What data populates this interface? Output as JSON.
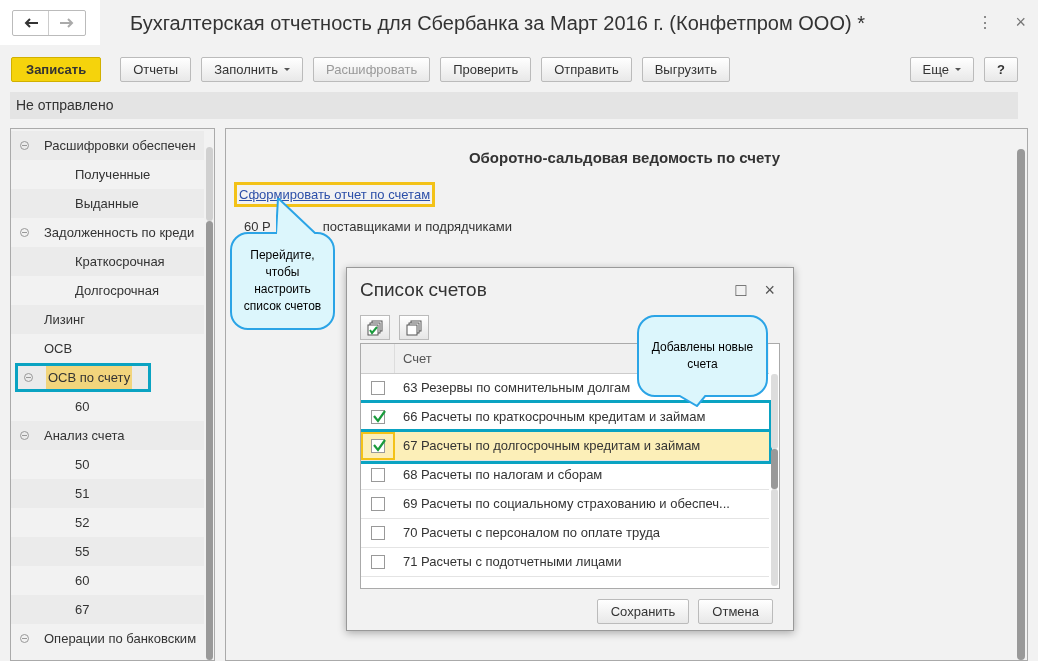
{
  "window": {
    "title": "Бухгалтерская отчетность для Сбербанка за Март 2016 г. (Конфетпром ООО) *",
    "forward_disabled": true,
    "more_icon": "⋮",
    "close_icon": "×"
  },
  "toolbar": {
    "buttons": [
      {
        "label": "Записать",
        "kind": "primary",
        "disabled": false,
        "dropdown": false
      },
      {
        "label": "Отчеты",
        "kind": "normal",
        "disabled": false,
        "dropdown": false
      },
      {
        "label": "Заполнить",
        "kind": "normal",
        "disabled": false,
        "dropdown": true
      },
      {
        "label": "Расшифровать",
        "kind": "normal",
        "disabled": true,
        "dropdown": false
      },
      {
        "label": "Проверить",
        "kind": "normal",
        "disabled": false,
        "dropdown": false
      },
      {
        "label": "Отправить",
        "kind": "normal",
        "disabled": false,
        "dropdown": false
      },
      {
        "label": "Выгрузить",
        "kind": "normal",
        "disabled": false,
        "dropdown": false
      }
    ],
    "right_buttons": [
      {
        "label": "Еще",
        "dropdown": true
      },
      {
        "label": "?",
        "dropdown": false
      }
    ]
  },
  "status": "Не отправлено",
  "sidebar": {
    "items": [
      {
        "label": "Расшифровки обеспечен",
        "expanded": true,
        "selected": false,
        "children": [
          {
            "label": "Полученные",
            "selected": false
          },
          {
            "label": "Выданные",
            "selected": false
          }
        ]
      },
      {
        "label": "Задолженность по креди",
        "expanded": true,
        "selected": false,
        "children": [
          {
            "label": "Краткосрочная",
            "selected": false
          },
          {
            "label": "Долгосрочная",
            "selected": false
          }
        ]
      },
      {
        "label": "Лизинг",
        "selected": false
      },
      {
        "label": "ОСВ",
        "selected": false
      },
      {
        "label": "ОСВ по счету",
        "expanded": true,
        "selected": true,
        "children": [
          {
            "label": "60",
            "selected": false
          }
        ]
      },
      {
        "label": "Анализ счета",
        "expanded": true,
        "selected": false,
        "children": [
          {
            "label": "50",
            "selected": false
          },
          {
            "label": "51",
            "selected": false
          },
          {
            "label": "52",
            "selected": false
          },
          {
            "label": "55",
            "selected": false
          },
          {
            "label": "60",
            "selected": false
          },
          {
            "label": "67",
            "selected": false
          }
        ]
      },
      {
        "label": "Операции по банковским",
        "expanded": true,
        "selected": false
      }
    ]
  },
  "report": {
    "title": "Оборотно-сальдовая ведомость по счету",
    "link": "Сформировать отчет по счетам",
    "account_start": "60 Р",
    "account_end": "поставщиками и подрядчиками"
  },
  "callouts": [
    {
      "text": "Перейдите, чтобы настроить список счетов"
    },
    {
      "text": "Добавлены новые счета"
    }
  ],
  "dialog": {
    "title": "Список счетов",
    "maximize_icon": "□",
    "close_icon": "×",
    "column": "Счет",
    "buttons": [
      "Сохранить",
      "Отмена"
    ],
    "rows": [
      {
        "label": "63 Резервы по сомнительным долгам",
        "checked": false,
        "selected": false,
        "highlighted": false
      },
      {
        "label": "66 Расчеты по краткосрочным кредитам и займам",
        "checked": true,
        "selected": false,
        "highlighted": true
      },
      {
        "label": "67 Расчеты по долгосрочным кредитам и займам",
        "checked": true,
        "selected": true,
        "highlighted": true
      },
      {
        "label": "68 Расчеты по налогам и сборам",
        "checked": false,
        "selected": false,
        "highlighted": false
      },
      {
        "label": "69 Расчеты по социальному страхованию и обеспеч...",
        "checked": false,
        "selected": false,
        "highlighted": false
      },
      {
        "label": "70 Расчеты с персоналом по оплате труда",
        "checked": false,
        "selected": false,
        "highlighted": false
      },
      {
        "label": "71 Расчеты с подотчетными лицами",
        "checked": false,
        "selected": false,
        "highlighted": false
      }
    ]
  }
}
